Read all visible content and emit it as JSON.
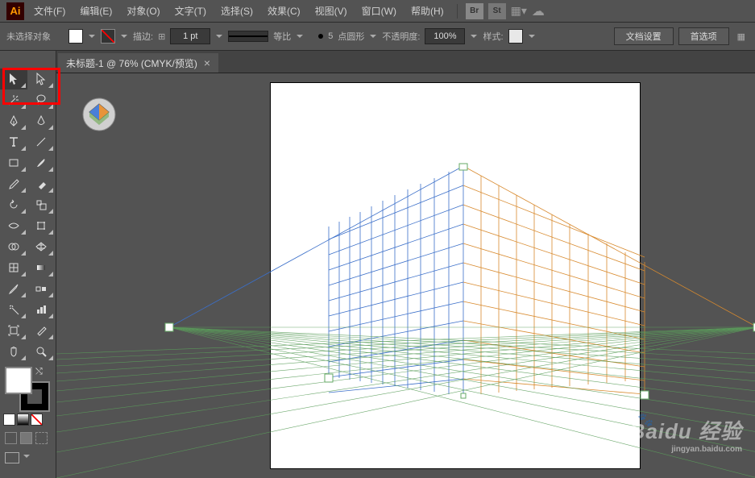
{
  "menu": {
    "logo": "Ai",
    "items": [
      "文件(F)",
      "编辑(E)",
      "对象(O)",
      "文字(T)",
      "选择(S)",
      "效果(C)",
      "视图(V)",
      "窗口(W)",
      "帮助(H)"
    ],
    "br": "Br",
    "st": "St"
  },
  "control": {
    "selection": "未选择对象",
    "stroke_label": "描边:",
    "stroke_weight": "1 pt",
    "profile": "等比",
    "point_count": "5",
    "brush_label": "点圆形",
    "opacity_label": "不透明度:",
    "opacity_value": "100%",
    "style_label": "样式:",
    "docsetup": "文档设置",
    "prefs": "首选项"
  },
  "tab": {
    "title": "未标题-1 @ 76% (CMYK/预览)",
    "close": "×"
  },
  "tools": {
    "names": [
      "selection-tool",
      "direct-selection-tool",
      "magic-wand-tool",
      "lasso-tool",
      "pen-tool",
      "curvature-tool",
      "type-tool",
      "line-tool",
      "rectangle-tool",
      "paintbrush-tool",
      "shaper-tool",
      "eraser-tool",
      "rotate-tool",
      "scale-tool",
      "width-tool",
      "free-transform-tool",
      "shape-builder-tool",
      "perspective-grid-tool",
      "mesh-tool",
      "gradient-tool",
      "eyedropper-tool",
      "blend-tool",
      "symbol-sprayer-tool",
      "column-graph-tool",
      "artboard-tool",
      "slice-tool",
      "hand-tool",
      "zoom-tool"
    ]
  },
  "watermark": {
    "brand": "Baidu 经验",
    "url": "jingyan.baidu.com"
  }
}
